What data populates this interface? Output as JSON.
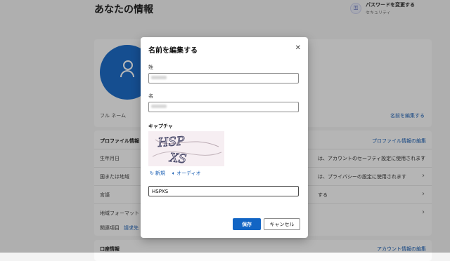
{
  "page": {
    "title": "あなたの情報",
    "password": {
      "title": "パスワードを変更する",
      "subtitle": "セキュリティ"
    }
  },
  "profile_card": {
    "fullname_label": "フル ネーム",
    "edit_name_link": "名前を編集する"
  },
  "profile_info": {
    "heading": "プロファイル情報",
    "edit_link": "プロファイル情報の編集",
    "rows": [
      {
        "label": "生年月日",
        "desc": "は、アカウントのセーフティ設定に使用されます"
      },
      {
        "label": "国または地域",
        "desc": "は、プライバシーの設定に使用されます"
      },
      {
        "label": "言語",
        "desc": "する"
      },
      {
        "label": "地域フォーマット",
        "desc": ""
      }
    ],
    "related_label": "関連項目",
    "related_link": "請求先"
  },
  "account_info": {
    "heading": "口座情報",
    "edit_link": "アカウント情報の編集"
  },
  "dialog": {
    "title": "名前を編集する",
    "last_name_label": "姓",
    "last_name_value": "",
    "first_name_label": "名",
    "first_name_value": "",
    "captcha_label": "キャプチャ",
    "captcha_image_text": "HSPXS",
    "new_label": "新規",
    "audio_label": "オーディオ",
    "captcha_value": "HSPXS",
    "save_label": "保存",
    "cancel_label": "キャンセル"
  },
  "colors": {
    "accent": "#1265c4",
    "link": "#1a5fb4",
    "avatar": "#1e6cc8"
  }
}
